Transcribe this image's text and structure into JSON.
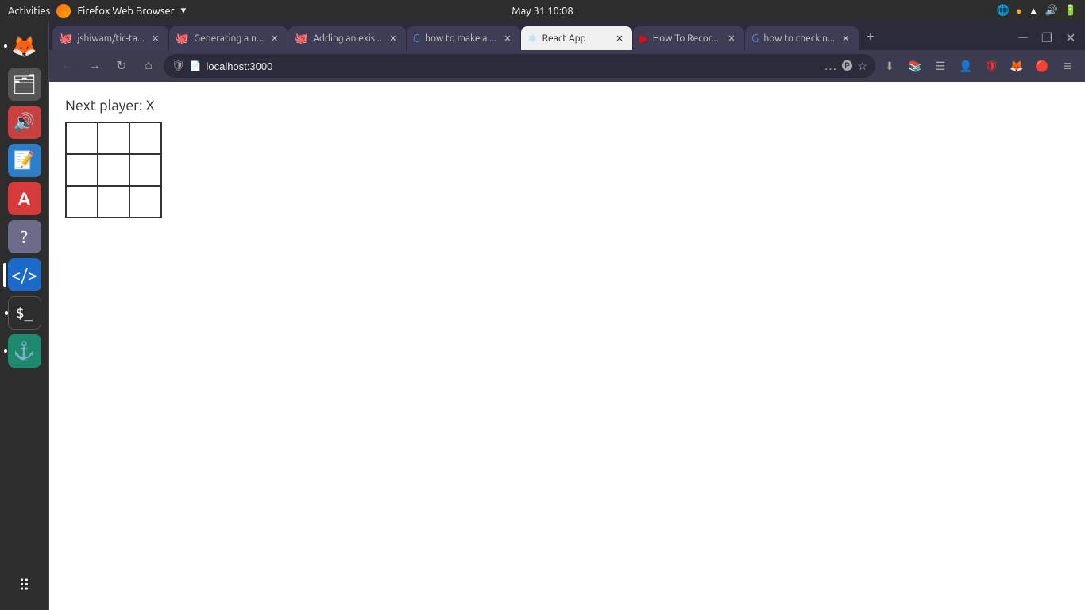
{
  "os": {
    "topbar": {
      "activities": "Activities",
      "app_name": "Firefox Web Browser",
      "datetime": "May 31  10:08",
      "dropdown_icon": "▾"
    }
  },
  "sidebar": {
    "icons": [
      {
        "name": "firefox-browser",
        "emoji": "🦊",
        "active": false,
        "dot": false
      },
      {
        "name": "files",
        "emoji": "🗂",
        "active": false,
        "dot": false
      },
      {
        "name": "audio",
        "emoji": "🎵",
        "active": false,
        "dot": false
      },
      {
        "name": "writer",
        "emoji": "📝",
        "active": false,
        "dot": false
      },
      {
        "name": "app-store",
        "emoji": "🅐",
        "active": false,
        "dot": false
      },
      {
        "name": "help",
        "emoji": "❓",
        "active": false,
        "dot": false
      },
      {
        "name": "vscode",
        "emoji": "💙",
        "active": true,
        "dot": false
      },
      {
        "name": "terminal",
        "emoji": "⬛",
        "active": false,
        "dot": false
      },
      {
        "name": "gitkraken",
        "emoji": "🐙",
        "active": false,
        "dot": false
      }
    ],
    "bottom_icons": [
      {
        "name": "apps-grid",
        "emoji": "⠿",
        "active": false
      }
    ]
  },
  "browser": {
    "tabs": [
      {
        "id": "tab1",
        "favicon": "🐙",
        "title": "jshiwam/tic-ta...",
        "active": false
      },
      {
        "id": "tab2",
        "favicon": "🐙",
        "title": "Generating a n...",
        "active": false
      },
      {
        "id": "tab3",
        "favicon": "🐙",
        "title": "Adding an exis...",
        "active": false
      },
      {
        "id": "tab4",
        "favicon": "🔍",
        "title": "how to make a ...",
        "active": false
      },
      {
        "id": "tab5",
        "favicon": "⚛",
        "title": "React App",
        "active": true
      },
      {
        "id": "tab6",
        "favicon": "🎥",
        "title": "How To Recor...",
        "active": false
      },
      {
        "id": "tab7",
        "favicon": "🔍",
        "title": "how to check n...",
        "active": false
      }
    ],
    "address_bar": {
      "url": "localhost:3000",
      "shield": "🛡",
      "page_icon": "📄"
    },
    "content": {
      "next_player_label": "Next player: X",
      "board": [
        [
          "",
          "",
          ""
        ],
        [
          "",
          "",
          ""
        ],
        [
          "",
          "",
          ""
        ]
      ]
    }
  },
  "icons": {
    "back": "←",
    "forward": "→",
    "reload": "↻",
    "home": "⌂",
    "more": "…",
    "pocket": "🅟",
    "bookmark": "☆",
    "download": "⬇",
    "library": "📚",
    "reader": "☰",
    "account": "👤",
    "shield_toolbar": "🛡",
    "addon1": "🦊",
    "addon2": "🔴",
    "menu": "≡",
    "minimize": "─",
    "maximize": "❐",
    "close": "✕",
    "new_tab": "+"
  }
}
